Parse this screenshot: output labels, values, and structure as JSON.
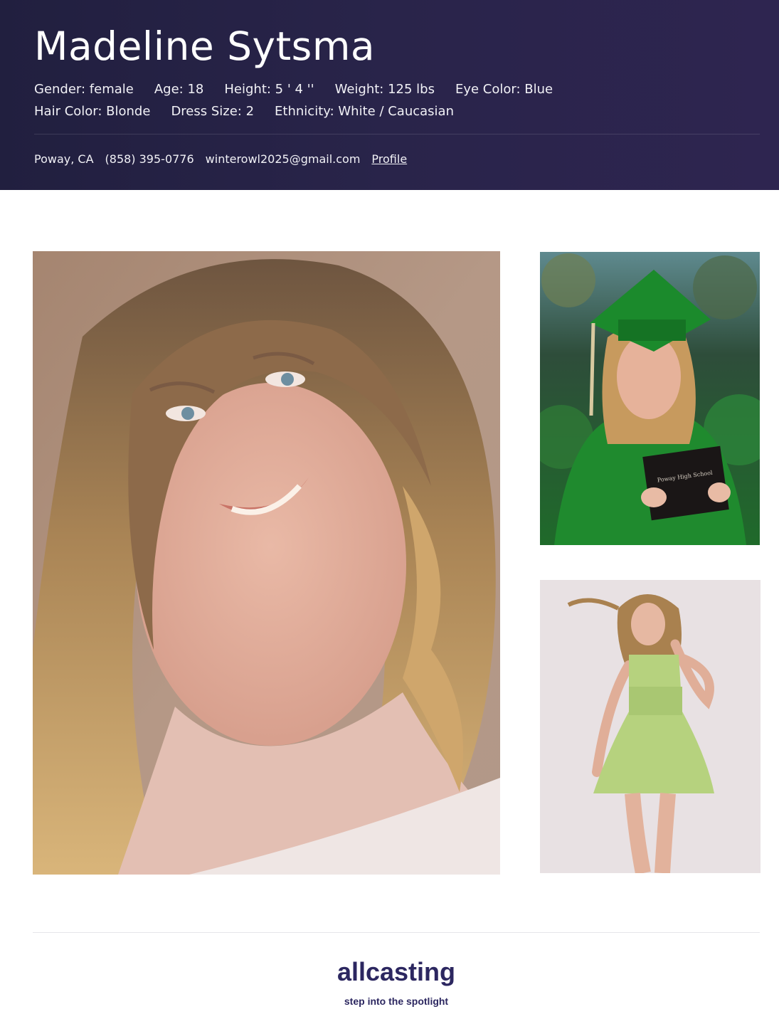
{
  "profile": {
    "name": "Madeline Sytsma",
    "attributes_row1": [
      "Gender: female",
      "Age: 18",
      "Height: 5 ' 4 ''",
      "Weight: 125 lbs",
      "Eye Color: Blue"
    ],
    "attributes_row2": [
      "Hair Color: Blonde",
      "Dress Size: 2",
      "Ethnicity: White / Caucasian"
    ],
    "contact": {
      "location": "Poway, CA",
      "phone": "(858) 395-0776",
      "email": "winterowl2025@gmail.com",
      "profile_link": "Profile"
    }
  },
  "photos": {
    "headshot": "headshot-photo",
    "graduation": "graduation-photo",
    "full_body": "green-dress-photo",
    "diploma_text": "Poway High School"
  },
  "footer": {
    "logo_text": "allcasting",
    "tagline": "step into the spotlight"
  },
  "colors": {
    "header_bg": "#26213f",
    "logo": "#2c2760",
    "text_on_header": "#ffffff"
  }
}
